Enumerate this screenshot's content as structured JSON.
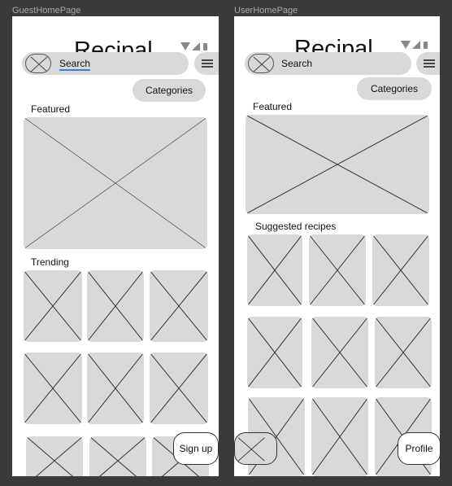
{
  "guest": {
    "frame_label": "GuestHomePage",
    "title": "Recipal",
    "search_label": "Search",
    "categories_label": "Categories",
    "featured_label": "Featured",
    "trending_label": "Trending",
    "signup_label": "Sign up"
  },
  "user": {
    "frame_label": "UserHomePage",
    "title": "Recipal",
    "search_label": "Search",
    "categories_label": "Categories",
    "featured_label": "Featured",
    "suggested_label": "Suggested recipes",
    "profile_label": "Profile"
  },
  "colors": {
    "canvas": "#3a3a3a",
    "placeholder": "#d9d9d9",
    "search_underline": "#3a7bd5"
  }
}
